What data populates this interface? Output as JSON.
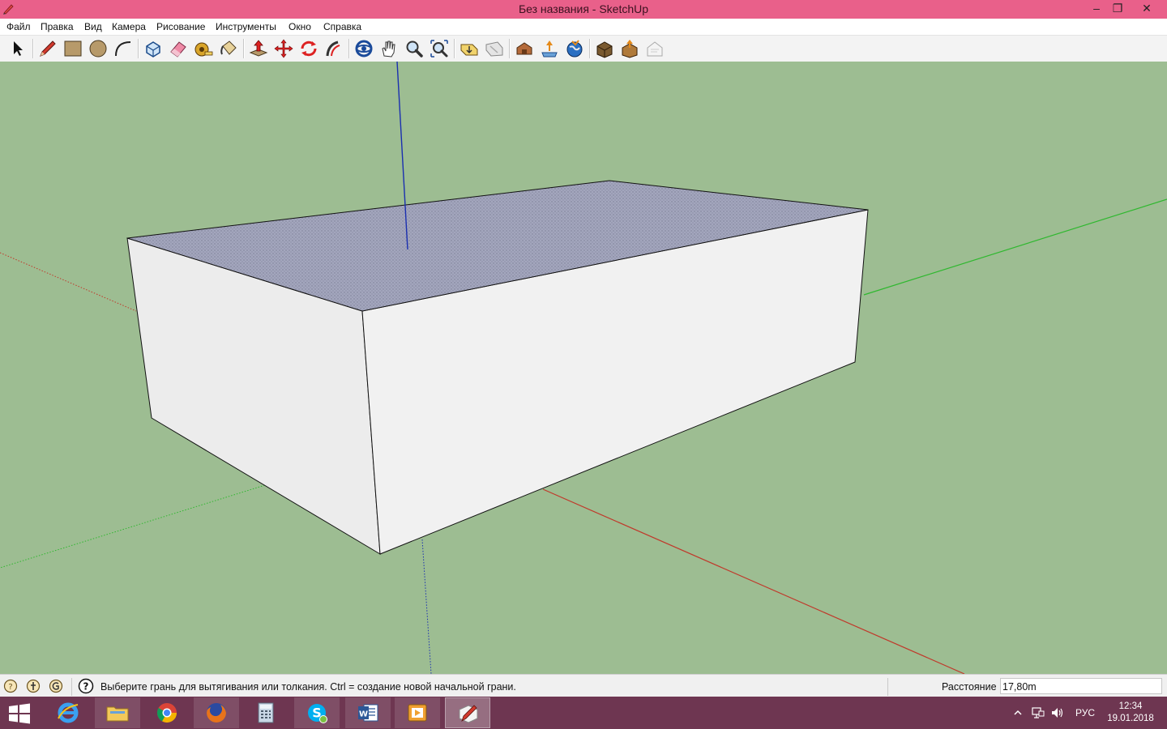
{
  "window": {
    "title": "Без названия - SketchUp",
    "controls": {
      "minimize": "‒",
      "maximize": "❐",
      "close": "✕"
    }
  },
  "menu": {
    "items": [
      "Файл",
      "Правка",
      "Вид",
      "Камера",
      "Рисование",
      "Инструменты",
      "Окно",
      "Справка"
    ]
  },
  "toolbar": {
    "tools": [
      {
        "name": "select-tool",
        "icon": "arrow-icon"
      },
      {
        "name": "line-tool",
        "icon": "pencil-icon"
      },
      {
        "name": "rectangle-tool",
        "icon": "rectangle-icon"
      },
      {
        "name": "circle-tool",
        "icon": "circle-icon"
      },
      {
        "name": "arc-tool",
        "icon": "arc-icon"
      },
      {
        "name": "make-component-tool",
        "icon": "component-icon"
      },
      {
        "name": "eraser-tool",
        "icon": "eraser-icon"
      },
      {
        "name": "tape-measure-tool",
        "icon": "tape-measure-icon"
      },
      {
        "name": "paint-bucket-tool",
        "icon": "paint-bucket-icon"
      },
      {
        "name": "push-pull-tool",
        "icon": "push-pull-icon"
      },
      {
        "name": "move-tool",
        "icon": "move-icon"
      },
      {
        "name": "rotate-tool",
        "icon": "rotate-icon"
      },
      {
        "name": "follow-me-tool",
        "icon": "follow-me-icon"
      },
      {
        "name": "orbit-tool",
        "icon": "orbit-icon"
      },
      {
        "name": "pan-tool",
        "icon": "hand-icon"
      },
      {
        "name": "zoom-tool",
        "icon": "magnifier-icon"
      },
      {
        "name": "zoom-extents-tool",
        "icon": "zoom-extents-icon"
      },
      {
        "name": "previous-view-tool",
        "icon": "previous-view-icon"
      },
      {
        "name": "next-view-tool",
        "icon": "next-view-icon"
      },
      {
        "name": "warehouse-tool",
        "icon": "warehouse-icon"
      },
      {
        "name": "share-model-tool",
        "icon": "share-model-icon"
      },
      {
        "name": "google-earth-tool",
        "icon": "globe-icon"
      },
      {
        "name": "extension-warehouse-tool",
        "icon": "extension-icon"
      },
      {
        "name": "share-component-tool",
        "icon": "share-component-icon"
      },
      {
        "name": "layout-tool",
        "icon": "layout-icon"
      }
    ]
  },
  "status": {
    "hint": "Выберите грань для вытягивания или толкания.  Ctrl = создание новой начальной грани.",
    "measure_label": "Расстояние",
    "measure_value": "17,80m"
  },
  "taskbar": {
    "apps": [
      {
        "name": "start-button",
        "icon": "windows-icon"
      },
      {
        "name": "internet-explorer",
        "icon": "ie-icon"
      },
      {
        "name": "file-explorer",
        "icon": "folder-icon"
      },
      {
        "name": "chrome",
        "icon": "chrome-icon"
      },
      {
        "name": "firefox",
        "icon": "firefox-icon"
      },
      {
        "name": "calculator",
        "icon": "calculator-icon"
      },
      {
        "name": "skype",
        "icon": "skype-icon"
      },
      {
        "name": "word",
        "icon": "word-icon"
      },
      {
        "name": "media-player",
        "icon": "media-icon"
      },
      {
        "name": "sketchup",
        "icon": "sketchup-icon"
      }
    ],
    "tray": {
      "language": "РУС",
      "time": "12:34",
      "date": "19.01.2018"
    }
  },
  "colors": {
    "titlebar": "#e9608a",
    "sky_ground": "#9dbd92",
    "roof": "#a3a6bd",
    "wall": "#f0f0f0",
    "axis_red": "#c0392b",
    "axis_green": "#2fb82f",
    "axis_blue": "#1a2fb0",
    "taskbar": "#6e3651"
  }
}
